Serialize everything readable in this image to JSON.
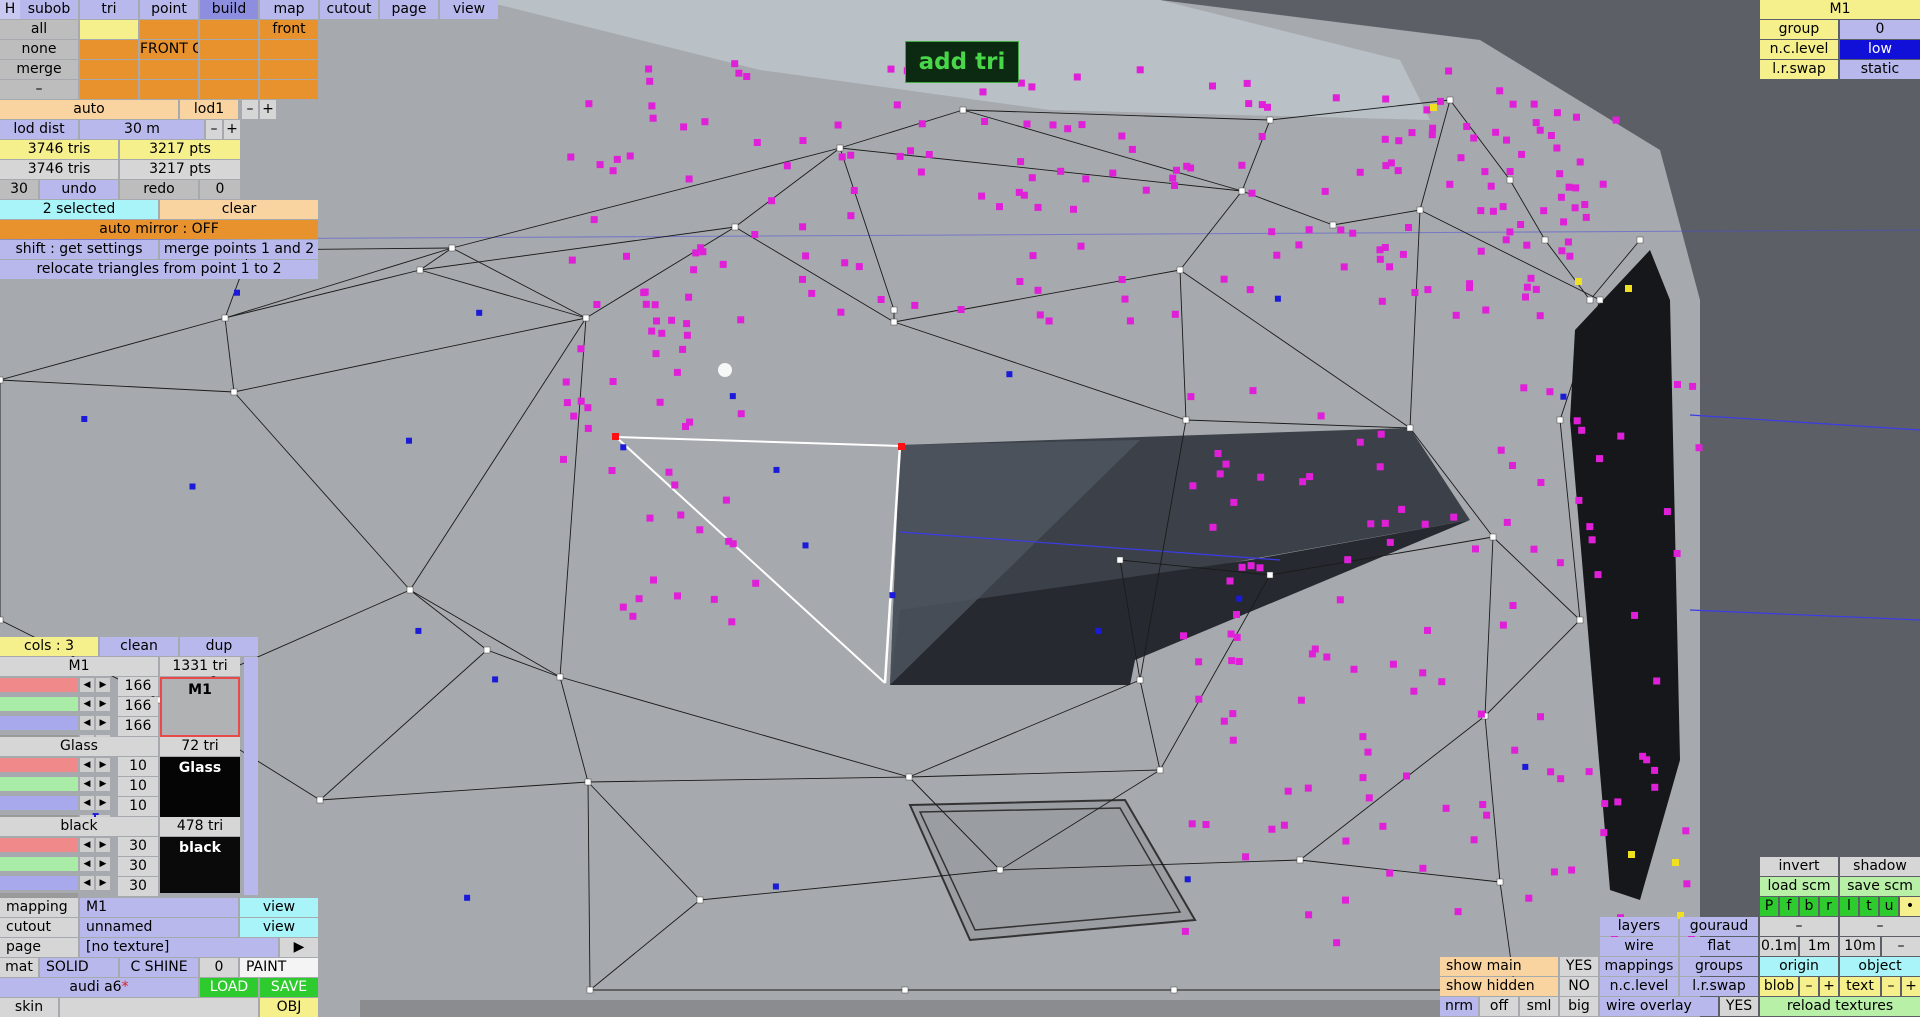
{
  "colors": {
    "background": "#5c6066",
    "mesh": "#a6a9ad",
    "lav": "#b8b8ec",
    "orange": "#e8922e"
  },
  "toolbar": {
    "h": "H",
    "tabs": [
      "subob",
      "tri",
      "point",
      "build",
      "map",
      "cutout",
      "page",
      "view"
    ],
    "active_tab": "build"
  },
  "sel_grid": {
    "rows": [
      [
        "all",
        "",
        "",
        "",
        "front"
      ],
      [
        "none",
        "",
        "FRONT G",
        "",
        ""
      ],
      [
        "merge",
        "",
        "",
        "",
        ""
      ],
      [
        "–",
        "",
        "",
        "",
        ""
      ]
    ]
  },
  "lod": {
    "auto": "auto",
    "lod1": "lod1",
    "minus": "–",
    "plus": "+",
    "dist_label": "lod dist",
    "dist_value": "30 m"
  },
  "stats": [
    {
      "tris": "3746 tris",
      "pts": "3217 pts"
    },
    {
      "tris": "3746 tris",
      "pts": "3217 pts"
    }
  ],
  "undo": {
    "count": "30",
    "undo": "undo",
    "redo": "redo",
    "redo_count": "0"
  },
  "selection": {
    "selected": "2 selected",
    "clear": "clear",
    "auto_mirror": "auto mirror : OFF",
    "shift": "shift : get settings",
    "merge": "merge points 1 and 2",
    "relocate": "relocate triangles from point 1 to 2"
  },
  "toast": "add tri",
  "cols": {
    "label": "cols : 3",
    "clean": "clean",
    "dup": "dup"
  },
  "materials": [
    {
      "name": "M1",
      "tris": "1331 tri",
      "vals": [
        "166",
        "166",
        "166"
      ],
      "preview": "M1",
      "preview_bg": "#b0b2b4",
      "preview_fg": "#000000"
    },
    {
      "name": "Glass",
      "tris": "72 tri",
      "vals": [
        "10",
        "10",
        "10"
      ],
      "preview": "Glass",
      "preview_bg": "#050505",
      "preview_fg": "#ffffff"
    },
    {
      "name": "black",
      "tris": "478 tri",
      "vals": [
        "30",
        "30",
        "30"
      ],
      "preview": "black",
      "preview_bg": "#0a0a0a",
      "preview_fg": "#ffffff"
    }
  ],
  "bottom_left": {
    "mapping_label": "mapping",
    "mapping_value": "M1",
    "view1": "view",
    "cutout_label": "cutout",
    "cutout_value": "unnamed",
    "view2": "view",
    "page_label": "page",
    "page_value": "[no texture]",
    "page_arrow": "▶",
    "mat": "mat",
    "solid": "SOLID",
    "cshine": "C SHINE",
    "zero": "0",
    "paint": "PAINT",
    "file": "audi a6",
    "file_mark": "*",
    "load": "LOAD",
    "save": "SAVE",
    "skin": "skin",
    "obj": "OBJ"
  },
  "top_right": {
    "title": "M1",
    "group_label": "group",
    "group_value": "0",
    "nclevel_label": "n.c.level",
    "nclevel_value": "low",
    "lrswap_label": "l.r.swap",
    "lrswap_value": "static"
  },
  "bottom_right": {
    "invert": "invert",
    "shadow": "shadow",
    "load_scm": "load scm",
    "save_scm": "save scm",
    "views": [
      "P",
      "f",
      "b",
      "r",
      "l",
      "t",
      "u",
      "•"
    ],
    "dash1": "–",
    "dash2": "–",
    "layers": "layers",
    "gouraud": "gouraud",
    "wire": "wire",
    "flat": "flat",
    "d1": "0.1m",
    "d2": "1m",
    "d3": "10m",
    "d4": "–",
    "show_main": "show main",
    "yes1": "YES",
    "mappings": "mappings",
    "groups": "groups",
    "origin": "origin",
    "object": "object",
    "show_hidden": "show hidden",
    "no1": "NO",
    "nclevel": "n.c.level",
    "lrswap": "l.r.swap",
    "blob": "blob",
    "bminus": "–",
    "bplus": "+",
    "text": "text",
    "tminus": "–",
    "tplus": "+",
    "nrm": "nrm",
    "off": "off",
    "sml": "sml",
    "big": "big",
    "wire_overlay": "wire overlay",
    "yes2": "YES",
    "reload": "reload textures"
  }
}
